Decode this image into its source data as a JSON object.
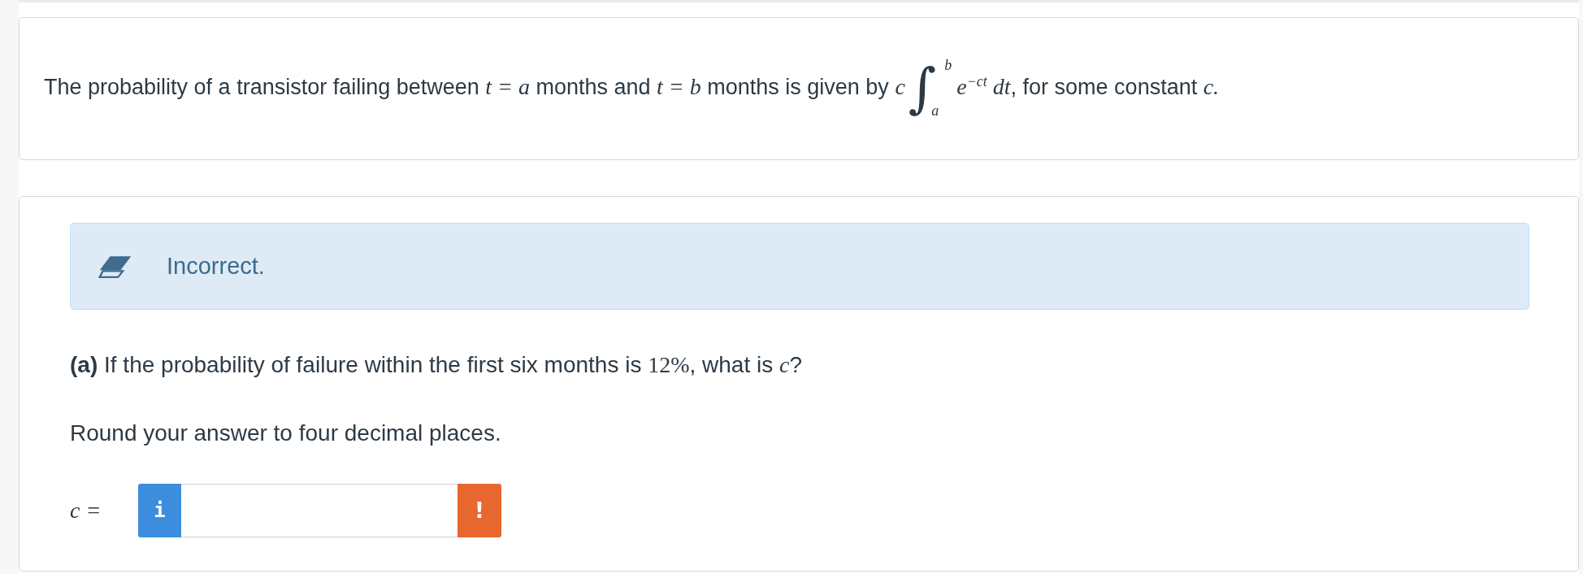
{
  "problem": {
    "segments": [
      {
        "kind": "text",
        "text": "The probability of a transistor failing between "
      },
      {
        "kind": "math",
        "text": "t = a"
      },
      {
        "kind": "text",
        "text": " months and "
      },
      {
        "kind": "math",
        "text": "t = b"
      },
      {
        "kind": "text",
        "text": " months is given by "
      },
      {
        "kind": "math",
        "text": "c"
      },
      {
        "kind": "integral",
        "sign": "∫",
        "lower": "a",
        "upper": "b"
      },
      {
        "kind": "math",
        "text": "e$^{−ct}$ dt"
      },
      {
        "kind": "text",
        "text": ", for some constant "
      },
      {
        "kind": "math",
        "text": "c."
      }
    ]
  },
  "feedback": {
    "kind": "incorrect",
    "text": "Incorrect."
  },
  "part": {
    "segments": [
      {
        "kind": "bold",
        "text": "(a)"
      },
      {
        "kind": "text",
        "text": " If the probability of failure within the first six months is "
      },
      {
        "kind": "number",
        "text": "12%"
      },
      {
        "kind": "text",
        "text": ", what is "
      },
      {
        "kind": "math",
        "text": "c"
      },
      {
        "kind": "text",
        "text": "?"
      }
    ]
  },
  "instruction": "Round your answer to four decimal places.",
  "answer": {
    "label": "c =",
    "info_button": "i",
    "warning_button": "!"
  }
}
